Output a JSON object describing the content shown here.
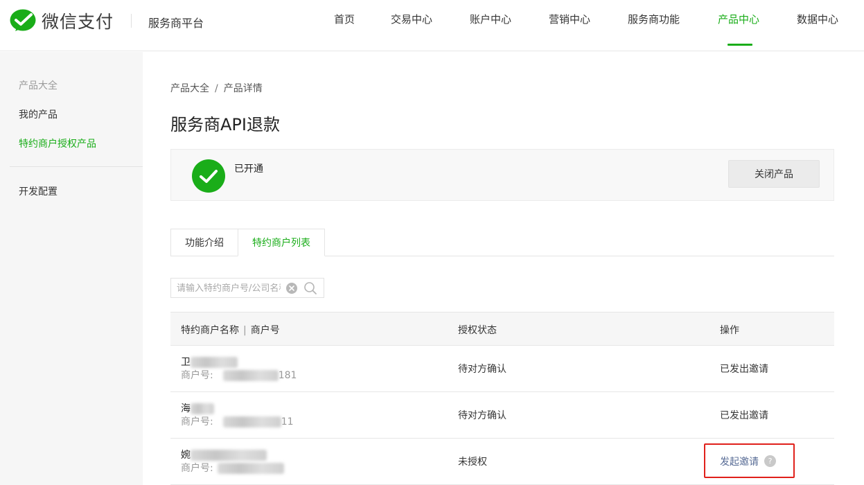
{
  "header": {
    "brand": "微信支付",
    "platform": "服务商平台",
    "nav": [
      "首页",
      "交易中心",
      "账户中心",
      "营销中心",
      "服务商功能",
      "产品中心",
      "数据中心"
    ],
    "active_nav": "产品中心",
    "accent_color": "#1aad19"
  },
  "sidebar": {
    "group_label": "产品大全",
    "items": [
      "我的产品",
      "特约商户授权产品"
    ],
    "active_item": "特约商户授权产品",
    "bottom_item": "开发配置"
  },
  "breadcrumb": [
    "产品大全",
    "产品详情"
  ],
  "page_title": "服务商API退款",
  "status": {
    "text": "已开通",
    "icon": "check-circle-icon",
    "close_button": "关闭产品"
  },
  "tabs": [
    "功能介绍",
    "特约商户列表"
  ],
  "active_tab": "特约商户列表",
  "search": {
    "placeholder": "请输入特约商户号/公司名称",
    "value": ""
  },
  "table": {
    "columns": {
      "merchant": "特约商户名称",
      "merchant_sep": "|",
      "merchant_no": "商户号",
      "status": "授权状态",
      "action": "操作"
    },
    "rows": [
      {
        "name_visible": "卫",
        "id_label": "商户号:",
        "id_visible_suffix": "181",
        "status": "待对方确认",
        "action": "已发出邀请",
        "action_link": false
      },
      {
        "name_visible": "海",
        "id_label": "商户号:",
        "id_visible_suffix": "11",
        "status": "待对方确认",
        "action": "已发出邀请",
        "action_link": false
      },
      {
        "name_visible": "婉",
        "id_label": "商户号:",
        "id_visible_suffix": "",
        "status": "未授权",
        "action": "发起邀请",
        "action_link": true,
        "help": "?"
      }
    ]
  },
  "colors": {
    "link": "#576b95",
    "highlight_box": "#e0201a"
  }
}
